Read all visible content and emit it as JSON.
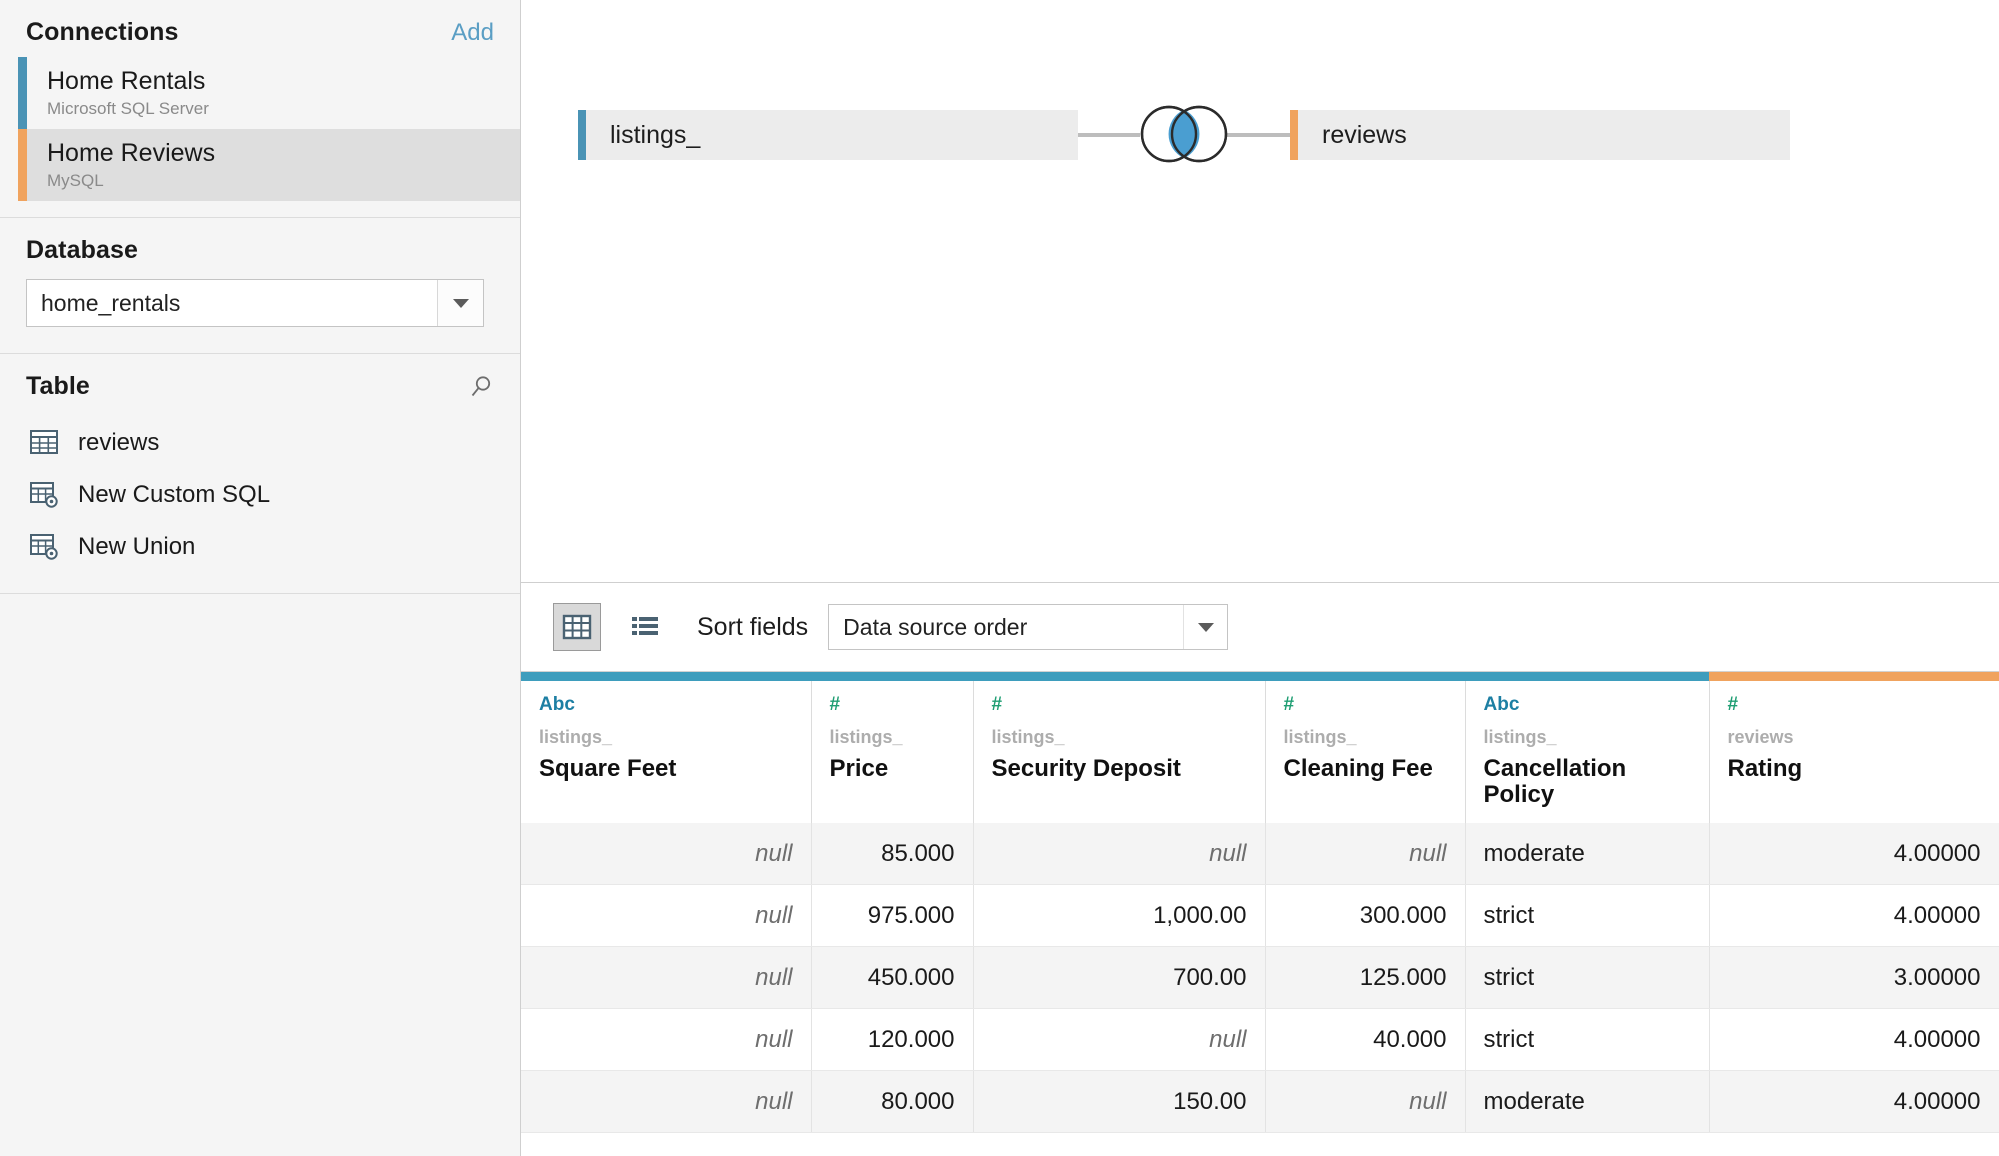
{
  "sidebar": {
    "connections": {
      "title": "Connections",
      "add_label": "Add",
      "items": [
        {
          "name": "Home Rentals",
          "type": "Microsoft SQL Server",
          "color": "#4a93b5",
          "selected": false
        },
        {
          "name": "Home Reviews",
          "type": "MySQL",
          "color": "#f0a35e",
          "selected": true
        }
      ]
    },
    "database": {
      "title": "Database",
      "selected": "home_rentals"
    },
    "table": {
      "title": "Table",
      "search_icon": "search-icon",
      "items": [
        {
          "label": "reviews",
          "icon": "table-icon"
        },
        {
          "label": "New Custom SQL",
          "icon": "table-gear-icon"
        },
        {
          "label": "New Union",
          "icon": "table-gear-icon"
        }
      ]
    }
  },
  "canvas": {
    "left_node": {
      "label": "listings_",
      "color": "#4a93b5"
    },
    "right_node": {
      "label": "reviews",
      "color": "#f0a35e"
    },
    "join": {
      "icon": "inner-join-venn-icon",
      "type": "Inner",
      "fill_color": "#4a9ed1"
    }
  },
  "toolbar": {
    "grid_view_icon": "grid-view-icon",
    "list_view_icon": "list-view-icon",
    "sort_label": "Sort fields",
    "sort_value": "Data source order"
  },
  "grid": {
    "columns": [
      {
        "type_label": "Abc",
        "type": "string",
        "source": "listings_",
        "name": "Square Feet",
        "accent": "#3e9dbd",
        "align": "num"
      },
      {
        "type_label": "#",
        "type": "number",
        "source": "listings_",
        "name": "Price",
        "accent": "#3e9dbd",
        "align": "num"
      },
      {
        "type_label": "#",
        "type": "number",
        "source": "listings_",
        "name": "Security Deposit",
        "accent": "#3e9dbd",
        "align": "num"
      },
      {
        "type_label": "#",
        "type": "number",
        "source": "listings_",
        "name": "Cleaning Fee",
        "accent": "#3e9dbd",
        "align": "num"
      },
      {
        "type_label": "Abc",
        "type": "string",
        "source": "listings_",
        "name": "Cancellation Policy",
        "accent": "#3e9dbd",
        "align": "txt"
      },
      {
        "type_label": "#",
        "type": "number",
        "source": "reviews",
        "name": "Rating",
        "accent": "#f0a35e",
        "align": "num"
      }
    ],
    "rows": [
      [
        "null",
        "85.000",
        "null",
        "null",
        "moderate",
        "4.00000"
      ],
      [
        "null",
        "975.000",
        "1,000.00",
        "300.000",
        "strict",
        "4.00000"
      ],
      [
        "null",
        "450.000",
        "700.00",
        "125.000",
        "strict",
        "3.00000"
      ],
      [
        "null",
        "120.000",
        "null",
        "40.000",
        "strict",
        "4.00000"
      ],
      [
        "null",
        "80.000",
        "150.00",
        "null",
        "moderate",
        "4.00000"
      ]
    ]
  }
}
